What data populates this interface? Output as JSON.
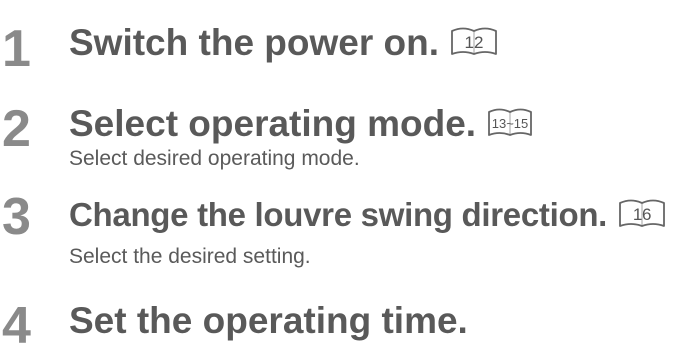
{
  "steps": [
    {
      "number": "1",
      "title": "Switch the power on.",
      "description": "",
      "page_ref": "12"
    },
    {
      "number": "2",
      "title": "Select operating mode.",
      "description": "Select desired operating mode.",
      "page_ref": "13~15"
    },
    {
      "number": "3",
      "title": "Change the louvre swing direction.",
      "description": "Select the desired setting.",
      "page_ref": "16"
    },
    {
      "number": "4",
      "title": "Set the operating time.",
      "description": "",
      "page_ref": ""
    }
  ],
  "colors": {
    "step_number": "#8a8a8a",
    "title": "#595959",
    "description": "#5a5a5a",
    "book_icon": "#666666"
  },
  "icons": {
    "page_reference": "open-book-icon"
  }
}
